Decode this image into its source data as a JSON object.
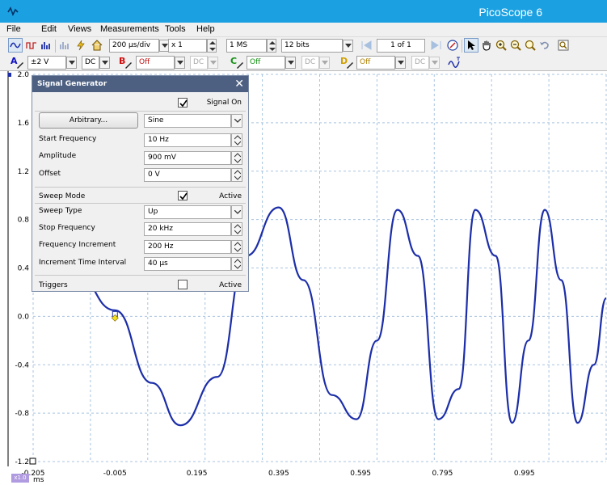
{
  "window": {
    "title": "PicoScope 6"
  },
  "menu": [
    "File",
    "Edit",
    "Views",
    "Measurements",
    "Tools",
    "Help"
  ],
  "toolbar": {
    "timebase": "200 µs/div",
    "zoom": "x 1",
    "samples": "1 MS",
    "resolution": "12 bits",
    "buffer": "1 of 1"
  },
  "channels": [
    {
      "letter": "A",
      "color": "#1010c0",
      "range": "±2 V",
      "coupling": "DC"
    },
    {
      "letter": "B",
      "color": "#d01010",
      "range": "Off",
      "coupling": "DC"
    },
    {
      "letter": "C",
      "color": "#109010",
      "range": "Off",
      "coupling": "DC"
    },
    {
      "letter": "D",
      "color": "#d0a000",
      "range": "Off",
      "coupling": "DC"
    }
  ],
  "signal_generator": {
    "title": "Signal Generator",
    "close": "✕",
    "signal_on_label": "Signal On",
    "arbitrary_button": "Arbitrary...",
    "waveform": "Sine",
    "start_frequency_label": "Start Frequency",
    "start_frequency": "10 Hz",
    "amplitude_label": "Amplitude",
    "amplitude": "900 mV",
    "offset_label": "Offset",
    "offset": "0 V",
    "sweep_mode_label": "Sweep Mode",
    "sweep_active_label": "Active",
    "sweep_type_label": "Sweep Type",
    "sweep_type": "Up",
    "stop_frequency_label": "Stop Frequency",
    "stop_frequency": "20 kHz",
    "frequency_increment_label": "Frequency Increment",
    "frequency_increment": "200 Hz",
    "increment_interval_label": "Increment Time Interval",
    "increment_interval": "40 µs",
    "triggers_label": "Triggers",
    "triggers_active_label": "Active",
    "signal_on": true,
    "sweep_active": true,
    "triggers_active": false
  },
  "plot": {
    "y_unit": "V",
    "y_ticks": [
      "2.0",
      "1.6",
      "1.2",
      "0.8",
      "0.4",
      "0.0",
      "-0.4",
      "-0.8",
      "-1.2"
    ],
    "x_ticks": [
      "-0.205",
      "-0.005",
      "0.195",
      "0.395",
      "0.595",
      "0.795",
      "0.995"
    ],
    "x_unit": "ms",
    "x_zoom_badge": "x1.0",
    "trace_color": "#1c2ea8",
    "grid_color": "#a8c4e0"
  },
  "chart_data": {
    "type": "line",
    "xlabel": "ms",
    "ylabel": "V",
    "xlim": [
      -0.205,
      1.195
    ],
    "ylim": [
      -1.2,
      2.0
    ],
    "series": [
      {
        "values_description_free": true,
        "x": [
          -0.205,
          -0.105,
          -0.005,
          0.085,
          0.155,
          0.245,
          0.315,
          0.395,
          0.455,
          0.525,
          0.585,
          0.635,
          0.685,
          0.735,
          0.785,
          0.835,
          0.875,
          0.925,
          0.965,
          1.005,
          1.045,
          1.085,
          1.125,
          1.165,
          1.195
        ],
        "y": [
          0.6,
          0.38,
          0.05,
          -0.55,
          -0.9,
          -0.5,
          0.5,
          0.9,
          0.3,
          -0.65,
          -0.85,
          -0.2,
          0.88,
          0.5,
          -0.85,
          -0.6,
          0.88,
          0.5,
          -0.88,
          -0.2,
          0.88,
          0.3,
          -0.88,
          -0.4,
          0.15
        ]
      }
    ]
  }
}
